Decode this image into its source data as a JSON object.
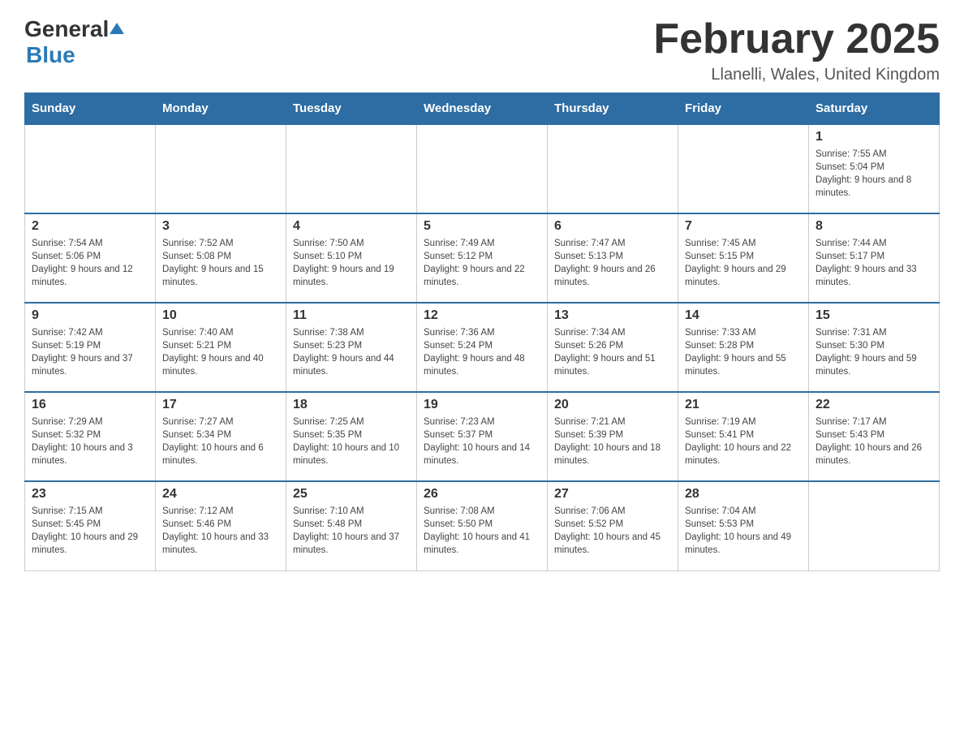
{
  "header": {
    "logo_general": "General",
    "logo_blue": "Blue",
    "month_title": "February 2025",
    "location": "Llanelli, Wales, United Kingdom"
  },
  "days_of_week": [
    "Sunday",
    "Monday",
    "Tuesday",
    "Wednesday",
    "Thursday",
    "Friday",
    "Saturday"
  ],
  "weeks": [
    {
      "days": [
        {
          "num": "",
          "info": ""
        },
        {
          "num": "",
          "info": ""
        },
        {
          "num": "",
          "info": ""
        },
        {
          "num": "",
          "info": ""
        },
        {
          "num": "",
          "info": ""
        },
        {
          "num": "",
          "info": ""
        },
        {
          "num": "1",
          "info": "Sunrise: 7:55 AM\nSunset: 5:04 PM\nDaylight: 9 hours and 8 minutes."
        }
      ]
    },
    {
      "days": [
        {
          "num": "2",
          "info": "Sunrise: 7:54 AM\nSunset: 5:06 PM\nDaylight: 9 hours and 12 minutes."
        },
        {
          "num": "3",
          "info": "Sunrise: 7:52 AM\nSunset: 5:08 PM\nDaylight: 9 hours and 15 minutes."
        },
        {
          "num": "4",
          "info": "Sunrise: 7:50 AM\nSunset: 5:10 PM\nDaylight: 9 hours and 19 minutes."
        },
        {
          "num": "5",
          "info": "Sunrise: 7:49 AM\nSunset: 5:12 PM\nDaylight: 9 hours and 22 minutes."
        },
        {
          "num": "6",
          "info": "Sunrise: 7:47 AM\nSunset: 5:13 PM\nDaylight: 9 hours and 26 minutes."
        },
        {
          "num": "7",
          "info": "Sunrise: 7:45 AM\nSunset: 5:15 PM\nDaylight: 9 hours and 29 minutes."
        },
        {
          "num": "8",
          "info": "Sunrise: 7:44 AM\nSunset: 5:17 PM\nDaylight: 9 hours and 33 minutes."
        }
      ]
    },
    {
      "days": [
        {
          "num": "9",
          "info": "Sunrise: 7:42 AM\nSunset: 5:19 PM\nDaylight: 9 hours and 37 minutes."
        },
        {
          "num": "10",
          "info": "Sunrise: 7:40 AM\nSunset: 5:21 PM\nDaylight: 9 hours and 40 minutes."
        },
        {
          "num": "11",
          "info": "Sunrise: 7:38 AM\nSunset: 5:23 PM\nDaylight: 9 hours and 44 minutes."
        },
        {
          "num": "12",
          "info": "Sunrise: 7:36 AM\nSunset: 5:24 PM\nDaylight: 9 hours and 48 minutes."
        },
        {
          "num": "13",
          "info": "Sunrise: 7:34 AM\nSunset: 5:26 PM\nDaylight: 9 hours and 51 minutes."
        },
        {
          "num": "14",
          "info": "Sunrise: 7:33 AM\nSunset: 5:28 PM\nDaylight: 9 hours and 55 minutes."
        },
        {
          "num": "15",
          "info": "Sunrise: 7:31 AM\nSunset: 5:30 PM\nDaylight: 9 hours and 59 minutes."
        }
      ]
    },
    {
      "days": [
        {
          "num": "16",
          "info": "Sunrise: 7:29 AM\nSunset: 5:32 PM\nDaylight: 10 hours and 3 minutes."
        },
        {
          "num": "17",
          "info": "Sunrise: 7:27 AM\nSunset: 5:34 PM\nDaylight: 10 hours and 6 minutes."
        },
        {
          "num": "18",
          "info": "Sunrise: 7:25 AM\nSunset: 5:35 PM\nDaylight: 10 hours and 10 minutes."
        },
        {
          "num": "19",
          "info": "Sunrise: 7:23 AM\nSunset: 5:37 PM\nDaylight: 10 hours and 14 minutes."
        },
        {
          "num": "20",
          "info": "Sunrise: 7:21 AM\nSunset: 5:39 PM\nDaylight: 10 hours and 18 minutes."
        },
        {
          "num": "21",
          "info": "Sunrise: 7:19 AM\nSunset: 5:41 PM\nDaylight: 10 hours and 22 minutes."
        },
        {
          "num": "22",
          "info": "Sunrise: 7:17 AM\nSunset: 5:43 PM\nDaylight: 10 hours and 26 minutes."
        }
      ]
    },
    {
      "days": [
        {
          "num": "23",
          "info": "Sunrise: 7:15 AM\nSunset: 5:45 PM\nDaylight: 10 hours and 29 minutes."
        },
        {
          "num": "24",
          "info": "Sunrise: 7:12 AM\nSunset: 5:46 PM\nDaylight: 10 hours and 33 minutes."
        },
        {
          "num": "25",
          "info": "Sunrise: 7:10 AM\nSunset: 5:48 PM\nDaylight: 10 hours and 37 minutes."
        },
        {
          "num": "26",
          "info": "Sunrise: 7:08 AM\nSunset: 5:50 PM\nDaylight: 10 hours and 41 minutes."
        },
        {
          "num": "27",
          "info": "Sunrise: 7:06 AM\nSunset: 5:52 PM\nDaylight: 10 hours and 45 minutes."
        },
        {
          "num": "28",
          "info": "Sunrise: 7:04 AM\nSunset: 5:53 PM\nDaylight: 10 hours and 49 minutes."
        },
        {
          "num": "",
          "info": ""
        }
      ]
    }
  ]
}
